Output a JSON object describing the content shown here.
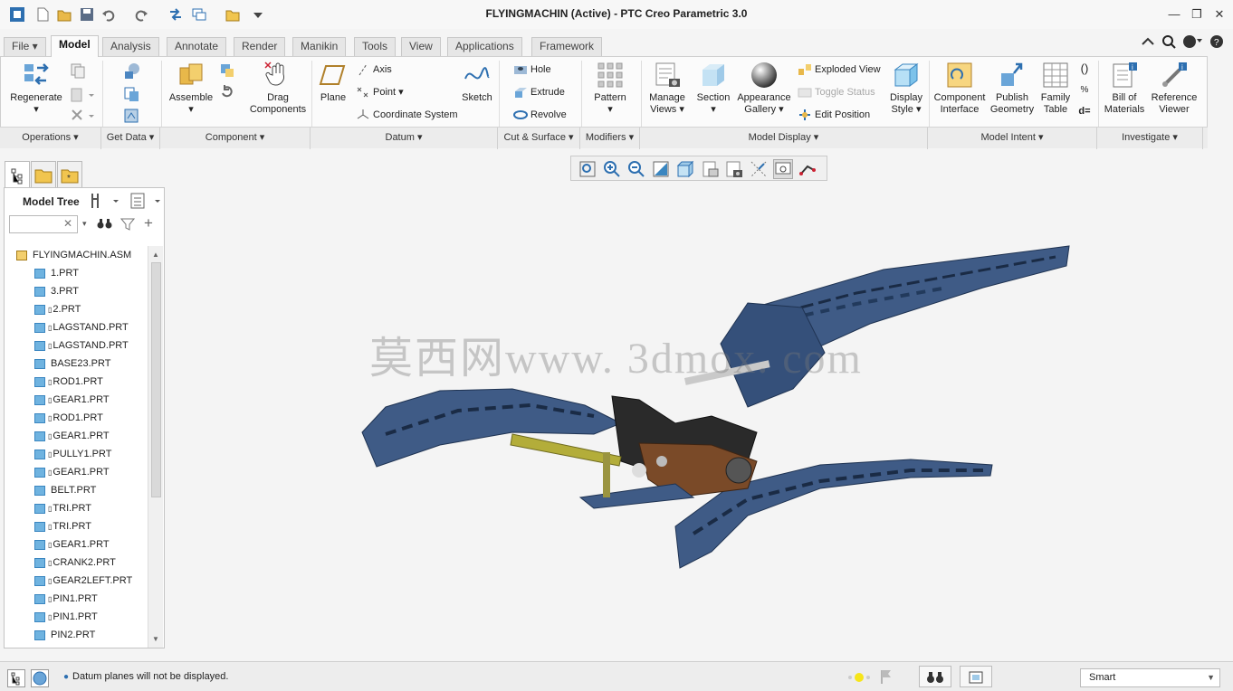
{
  "window": {
    "title": "FLYINGMACHIN (Active) - PTC Creo Parametric 3.0"
  },
  "menu_tabs": [
    "File",
    "Model",
    "Analysis",
    "Annotate",
    "Render",
    "Manikin",
    "Tools",
    "View",
    "Applications",
    "Framework"
  ],
  "active_tab": "Model",
  "ribbon": {
    "regenerate": "Regenerate",
    "assemble": "Assemble",
    "drag_components": [
      "Drag",
      "Components"
    ],
    "plane": "Plane",
    "axis": "Axis",
    "point": "Point",
    "coordinate_system": "Coordinate System",
    "sketch": "Sketch",
    "hole": "Hole",
    "extrude": "Extrude",
    "revolve": "Revolve",
    "pattern": "Pattern",
    "manage_views": [
      "Manage",
      "Views"
    ],
    "section": "Section",
    "appearance_gallery": [
      "Appearance",
      "Gallery"
    ],
    "exploded_view": "Exploded View",
    "toggle_status": "Toggle Status",
    "edit_position": "Edit Position",
    "display_style": [
      "Display",
      "Style"
    ],
    "component_interface": [
      "Component",
      "Interface"
    ],
    "publish_geometry": [
      "Publish",
      "Geometry"
    ],
    "family_table": [
      "Family",
      "Table"
    ],
    "bill_of_materials": [
      "Bill of",
      "Materials"
    ],
    "reference_viewer": [
      "Reference",
      "Viewer"
    ]
  },
  "groups": [
    "Operations",
    "Get Data",
    "Component",
    "Datum",
    "Cut & Surface",
    "Modifiers",
    "Model Display",
    "Model Intent",
    "Investigate"
  ],
  "model_tree": {
    "title": "Model Tree",
    "search_value": "",
    "root": "FLYINGMACHIN.ASM",
    "items": [
      "1.PRT",
      "3.PRT",
      "2.PRT",
      "LAGSTAND.PRT",
      "LAGSTAND.PRT",
      "BASE23.PRT",
      "ROD1.PRT",
      "GEAR1.PRT",
      "ROD1.PRT",
      "GEAR1.PRT",
      "PULLY1.PRT",
      "GEAR1.PRT",
      "BELT.PRT",
      "TRI.PRT",
      "TRI.PRT",
      "GEAR1.PRT",
      "CRANK2.PRT",
      "GEAR2LEFT.PRT",
      "PIN1.PRT",
      "PIN1.PRT",
      "PIN2.PRT"
    ]
  },
  "watermark": "莫西网www. 3dmox. com",
  "status": {
    "message": "Datum planes will not be displayed.",
    "filter": "Smart"
  },
  "colors": {
    "model_blue": "#3f5b86",
    "accent": "#2b6bb4",
    "background": "#f4f4f4"
  }
}
